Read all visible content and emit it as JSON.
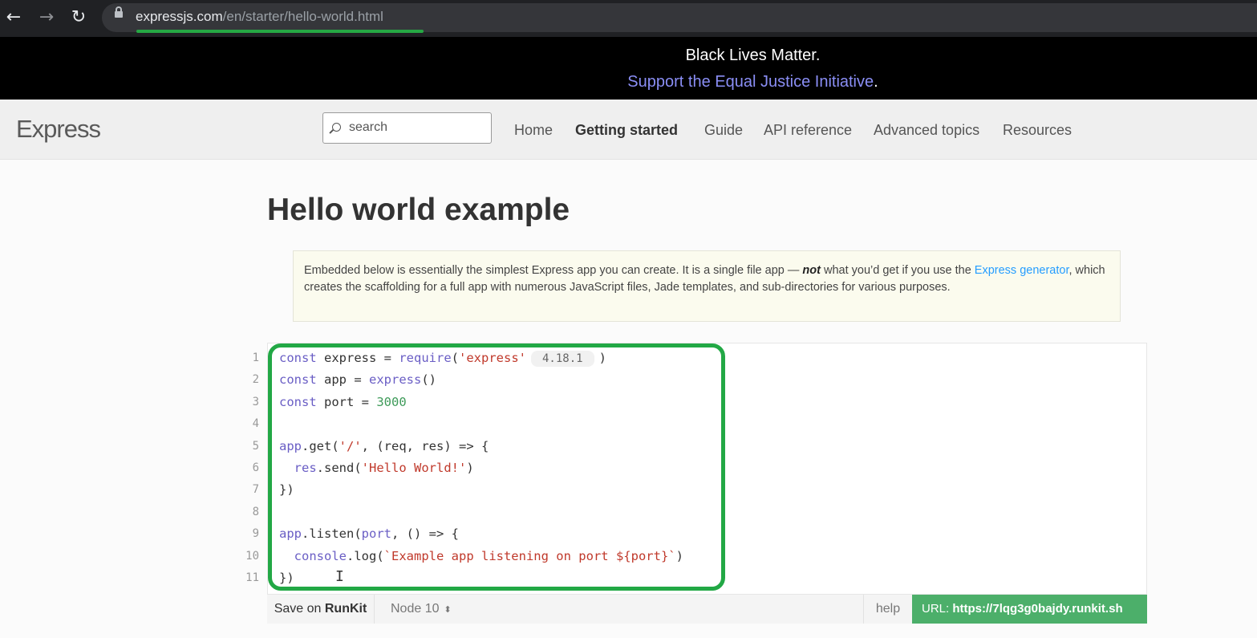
{
  "browser": {
    "url_host": "expressjs.com",
    "url_path": "/en/starter/hello-world.html"
  },
  "banner": {
    "line1": "Black Lives Matter.",
    "link": "Support the Equal Justice Initiative",
    "link_suffix": "."
  },
  "header": {
    "logo": "Express",
    "search_placeholder": "search",
    "menu": [
      "Home",
      "Getting started",
      "Guide",
      "API reference",
      "Advanced topics",
      "Resources"
    ],
    "active": "Getting started"
  },
  "main": {
    "title": "Hello world example",
    "note": {
      "part1": "Embedded below is essentially the simplest Express app you can create. It is a single file app — ",
      "emph": "not",
      "part2": " what you’d get if you use the ",
      "link": "Express generator",
      "part3": ", which creates the scaffolding for a full app with numerous JavaScript files, Jade templates, and sub-directories for various purposes."
    }
  },
  "code": {
    "line_numbers": [
      "1",
      "2",
      "3",
      "4",
      "5",
      "6",
      "7",
      "8",
      "9",
      "10",
      "11"
    ],
    "version_badge": "4.18.1"
  },
  "embed_bar": {
    "save_prefix": "Save on",
    "save_brand": "RunKit",
    "node_version": "Node 10",
    "help": "help",
    "url_label": "URL:",
    "url_value": "https://7lqg3g0bajdy.runkit.sh"
  },
  "colors": {
    "highlight": "#22a845",
    "runkit_green": "#4caf6a",
    "link_blue": "#259dff"
  }
}
